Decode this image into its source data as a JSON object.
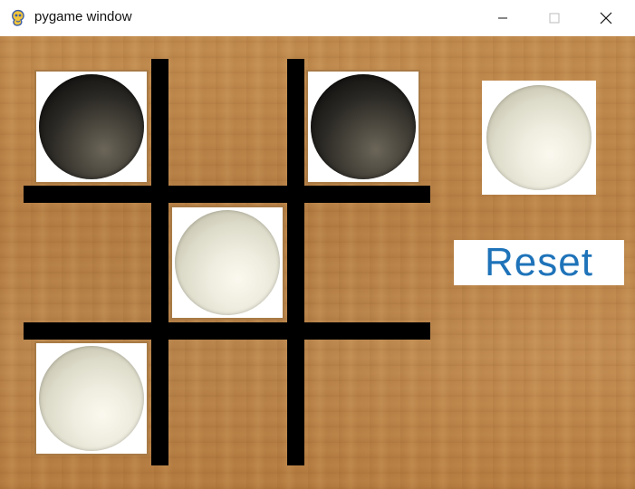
{
  "window": {
    "title": "pygame window",
    "icon": "pygame-snake-icon",
    "controls": [
      "minimize-icon",
      "maximize-icon",
      "close-icon"
    ]
  },
  "board": {
    "size": 3,
    "cells": [
      [
        "black",
        "",
        "black"
      ],
      [
        "",
        "white",
        ""
      ],
      [
        "white",
        "",
        ""
      ]
    ]
  },
  "turn_indicator": {
    "piece": "white"
  },
  "reset_button": {
    "label": "Reset"
  },
  "colors": {
    "board_lines": "#000000",
    "reset_text": "#1e73b9",
    "wood": "#bb8448",
    "tile_background": "#ffffff"
  }
}
